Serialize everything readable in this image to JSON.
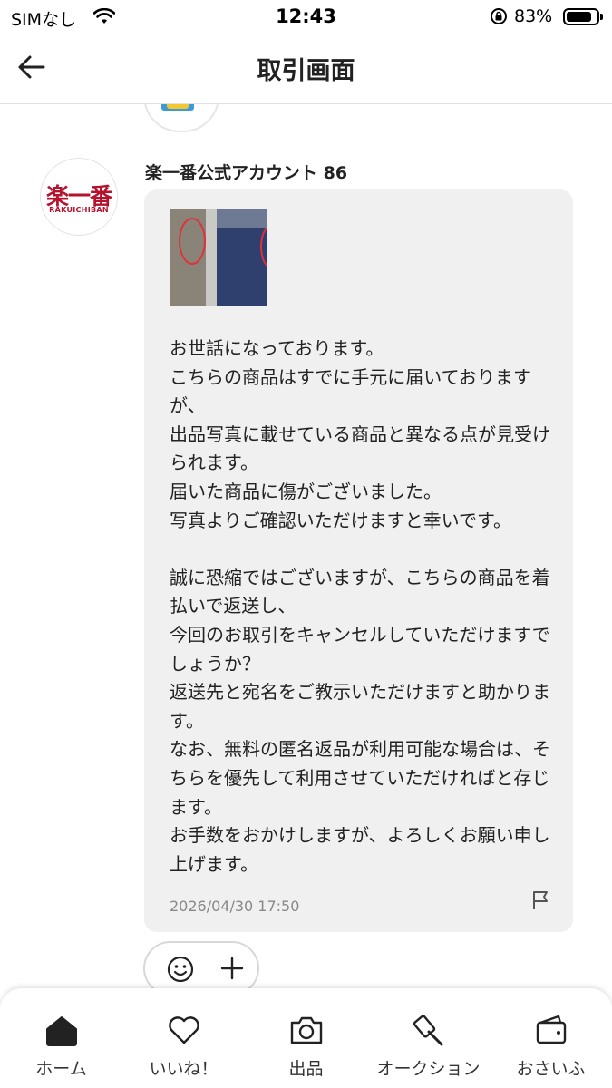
{
  "status_bar": {
    "carrier": "SIMなし",
    "time": "12:43",
    "battery_percent": "83%",
    "battery_level": 0.83
  },
  "header": {
    "title": "取引画面"
  },
  "sender": {
    "name": "楽一番公式アカウント 86",
    "logo_text": "楽一番",
    "logo_subtext": "RAKUICHIBAN"
  },
  "message": {
    "text": "お世話になっております。\nこちらの商品はすでに手元に届いておりますが、\n出品写真に載せている商品と異なる点が見受けられます。\n届いた商品に傷がございました。\n写真よりご確認いただけますと幸いです。\n\n誠に恐縮ではございますが、こちらの商品を着払いで返送し、\n今回のお取引をキャンセルしていただけますでしょうか？\n返送先と宛名をご教示いただけますと助かります。\nなお、無料の匿名返品が利用可能な場合は、そちらを優先して利用させていただければと存じます。\nお手数をおかけしますが、よろしくお願い申し上げます。",
    "timestamp": "2026/04/30 17:50"
  },
  "tabs": [
    {
      "label": "ホーム",
      "icon": "home-icon",
      "active": true
    },
    {
      "label": "いいね！",
      "icon": "heart-icon"
    },
    {
      "label": "出品",
      "icon": "camera-icon"
    },
    {
      "label": "オークション",
      "icon": "auction-hammer-icon"
    },
    {
      "label": "おさいふ",
      "icon": "wallet-icon"
    }
  ],
  "colors": {
    "bubble": "#f0f0f0",
    "logo_red": "#b5122d",
    "timestamp": "#888888"
  }
}
